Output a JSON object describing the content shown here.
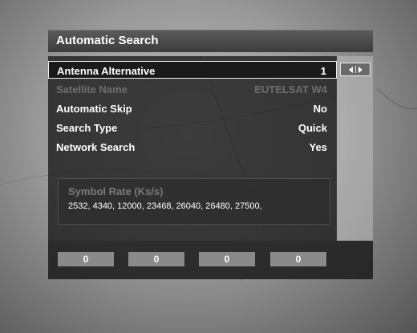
{
  "title": "Automatic Search",
  "rows": [
    {
      "label": "Antenna Alternative",
      "value": "1"
    },
    {
      "label": "Satellite Name",
      "value": "EUTELSAT W4"
    },
    {
      "label": "Automatic Skip",
      "value": "No"
    },
    {
      "label": "Search Type",
      "value": "Quick"
    },
    {
      "label": "Network Search",
      "value": "Yes"
    }
  ],
  "symbol_rate": {
    "heading": "Symbol Rate (Ks/s)",
    "values": "2532, 4340, 12000, 23468, 26040, 26480, 27500,"
  },
  "bottom_boxes": [
    "0",
    "0",
    "0",
    "0"
  ],
  "icons": {
    "nav": "left-right-arrows-icon"
  }
}
